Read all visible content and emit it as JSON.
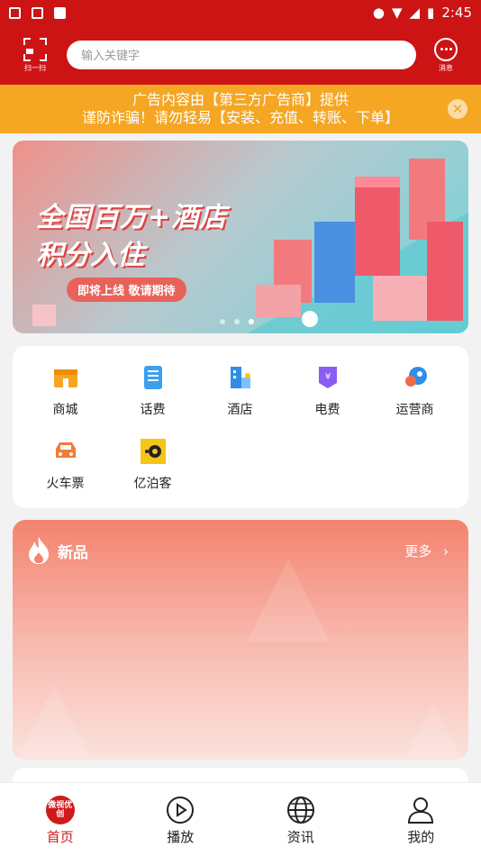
{
  "status_bar": {
    "time": "2:45",
    "icons": [
      "mail-icon",
      "grid-icon",
      "a-icon"
    ],
    "right_icons": [
      "location-icon",
      "wifi-icon",
      "signal-icon",
      "battery-icon"
    ]
  },
  "header": {
    "scan_label": "扫一扫",
    "search_placeholder": "输入关键字",
    "message_label": "消息"
  },
  "notice": {
    "line1": "广告内容由【第三方广告商】提供",
    "line2": "谨防诈骗！请勿轻易【安装、充值、转账、下单】"
  },
  "banner": {
    "line1": "全国百万+酒店",
    "line2": "积分入住",
    "tag": "即将上线 敬请期待",
    "active_dot": 3,
    "dot_count": 3
  },
  "grid": {
    "items": [
      {
        "label": "商城",
        "icon": "shop-icon",
        "color": "#f5a623"
      },
      {
        "label": "话费",
        "icon": "phone-bill-icon",
        "color": "#3aa0f0"
      },
      {
        "label": "酒店",
        "icon": "hotel-icon",
        "color": "#2f8fe8"
      },
      {
        "label": "电费",
        "icon": "electric-bill-icon",
        "color": "#8a5cf0"
      },
      {
        "label": "运营商",
        "icon": "operator-icon",
        "color": "#2f8fe8"
      },
      {
        "label": "火车票",
        "icon": "train-ticket-icon",
        "color": "#f07b3a"
      },
      {
        "label": "亿泊客",
        "icon": "yiboke-icon",
        "color": "#f5c518"
      }
    ]
  },
  "new_products": {
    "title": "新品",
    "more": "更多"
  },
  "bottom_nav": [
    {
      "label": "首页",
      "icon": "home-logo-icon",
      "active": true,
      "badge_text": "微视优创"
    },
    {
      "label": "播放",
      "icon": "play-icon",
      "active": false
    },
    {
      "label": "资讯",
      "icon": "globe-icon",
      "active": false
    },
    {
      "label": "我的",
      "icon": "user-icon",
      "active": false
    }
  ]
}
